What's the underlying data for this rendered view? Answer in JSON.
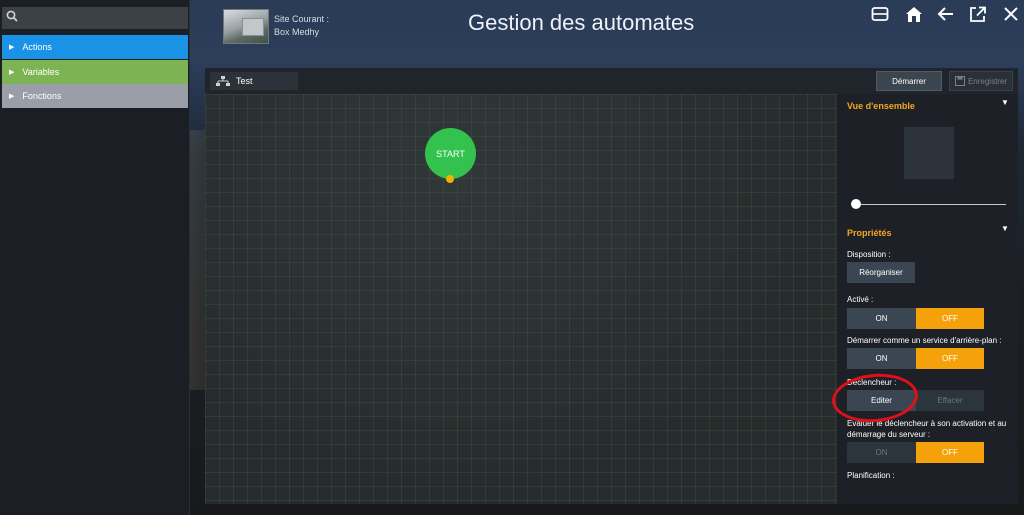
{
  "search": {
    "value": "",
    "placeholder": ""
  },
  "sidebar": {
    "items": [
      {
        "label": "Actions",
        "color": "#1a93e6"
      },
      {
        "label": "Variables",
        "color": "#7db453"
      },
      {
        "label": "Fonctions",
        "color": "#9a9ea8"
      }
    ]
  },
  "header": {
    "site_label": "Site Courant :",
    "site_name": "Box Medhy",
    "title": "Gestion des automates",
    "icons": [
      "inbox-icon",
      "home-icon",
      "back-arrow-icon",
      "external-link-icon",
      "close-icon"
    ]
  },
  "toolbar": {
    "tab_label": "Test",
    "start_label": "Démarrer",
    "save_label": "Enregistrer"
  },
  "canvas": {
    "start_node_label": "START"
  },
  "panel": {
    "overview_title": "Vue d'ensemble",
    "properties_title": "Propriétés",
    "disposition_label": "Disposition :",
    "reorganize_label": "Réorganiser",
    "active_label": "Activé :",
    "background_label": "Démarrer comme un service d'arrière-plan :",
    "trigger_label": "Déclencheur :",
    "edit_label": "Editer",
    "clear_label": "Effacer",
    "evaluate_label_line1": "Evaluer le déclencheur à son activation et au",
    "evaluate_label_line2": "démarrage du serveur :",
    "planning_label": "Planification :",
    "on_label": "ON",
    "off_label": "OFF"
  },
  "colors": {
    "accent": "#f5a20a",
    "start_node": "#33c24d",
    "annotation": "#e0101a"
  }
}
